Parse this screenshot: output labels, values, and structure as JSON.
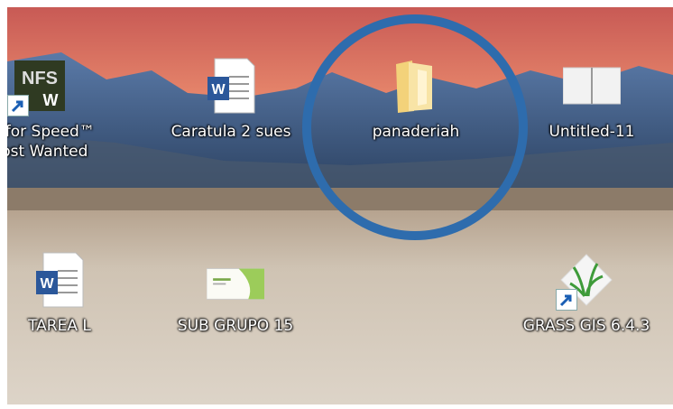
{
  "desktop": {
    "icons": [
      {
        "label_line1": "ed for Speed™",
        "label_line2": "Most Wanted",
        "icon": "nfs-game-shortcut-icon"
      },
      {
        "label_line1": "Caratula 2 sue",
        "label_line2": "s",
        "icon": "word-document-icon"
      },
      {
        "label_line1": "panaderiah",
        "icon": "folder-icon"
      },
      {
        "label_line1": "Untitled-11",
        "icon": "notebook-file-icon"
      },
      {
        "label_line1": "TAREA L",
        "icon": "word-document-icon"
      },
      {
        "label_line1": "SUB GRUPO 15",
        "icon": "business-card-image-icon"
      },
      {
        "label_line1": "GRASS GIS 6.4.3",
        "icon": "grass-gis-shortcut-icon"
      }
    ],
    "highlight_color": "#2e6cad"
  }
}
